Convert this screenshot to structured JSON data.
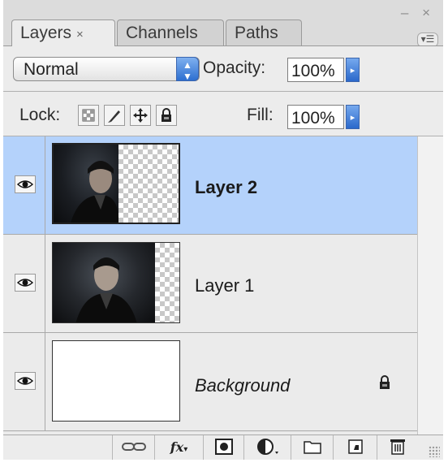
{
  "window": {
    "controls": "– ×"
  },
  "tabs": [
    {
      "label": "Layers",
      "close": "×",
      "active": true
    },
    {
      "label": "Channels",
      "active": false
    },
    {
      "label": "Paths",
      "active": false
    }
  ],
  "panel_menu_icon": "panel-menu-icon",
  "blend_mode": {
    "value": "Normal"
  },
  "opacity": {
    "label": "Opacity:",
    "value": "100%"
  },
  "lock": {
    "label": "Lock:",
    "icons": [
      "lock-transparent-pixels-icon",
      "lock-image-pixels-icon",
      "lock-position-icon",
      "lock-all-icon"
    ]
  },
  "fill": {
    "label": "Fill:",
    "value": "100%"
  },
  "layers": [
    {
      "name": "Layer 2",
      "selected": true,
      "visible": true
    },
    {
      "name": "Layer 1",
      "selected": false,
      "visible": true
    },
    {
      "name": "Background",
      "selected": false,
      "visible": true,
      "locked": true
    }
  ],
  "bottom_bar": [
    "link-layers-icon",
    "fx-icon",
    "add-mask-icon",
    "adjustment-layer-icon",
    "new-group-icon",
    "new-layer-icon",
    "trash-icon"
  ],
  "bottom_bar_fx": "fx",
  "colors": {
    "selection": "#b4d2fb",
    "accent": "#2d6fd0"
  }
}
